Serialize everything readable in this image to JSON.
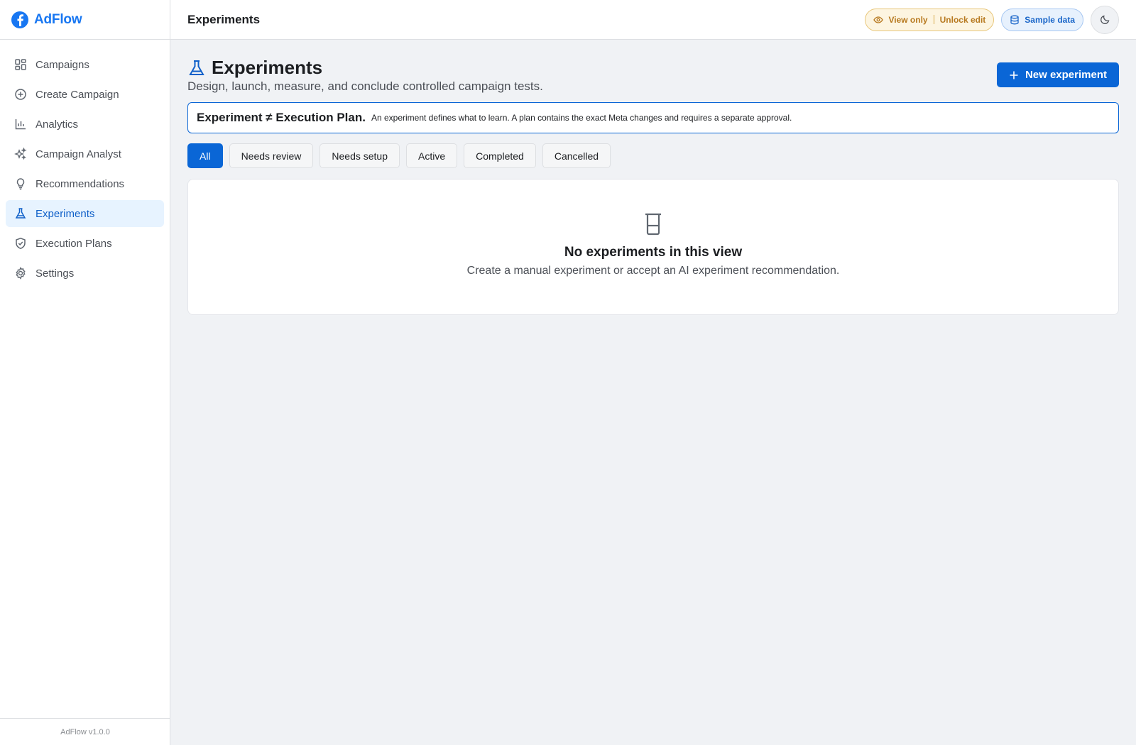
{
  "app": {
    "name": "AdFlow",
    "version": "AdFlow v1.0.0",
    "accent": "#1877f2"
  },
  "sidebar": {
    "items": [
      {
        "label": "Campaigns",
        "icon": "grid-icon"
      },
      {
        "label": "Create Campaign",
        "icon": "plus-circle-icon"
      },
      {
        "label": "Analytics",
        "icon": "bar-chart-icon"
      },
      {
        "label": "Campaign Analyst",
        "icon": "sparkles-icon"
      },
      {
        "label": "Recommendations",
        "icon": "lightbulb-icon"
      },
      {
        "label": "Experiments",
        "icon": "flask-icon",
        "active": true
      },
      {
        "label": "Execution Plans",
        "icon": "shield-check-icon"
      },
      {
        "label": "Settings",
        "icon": "gear-icon"
      }
    ]
  },
  "topbar": {
    "title": "Experiments",
    "view_only": "View only",
    "unlock_edit": "Unlock edit",
    "sample_data": "Sample data"
  },
  "main": {
    "title": "Experiments",
    "subtitle": "Design, launch, measure, and conclude controlled campaign tests.",
    "new_button": "New experiment",
    "callout": {
      "strong": "Experiment ≠ Execution Plan.",
      "text": "An experiment defines what to learn. A plan contains the exact Meta changes and requires a separate approval."
    },
    "tabs": [
      {
        "label": "All",
        "active": true
      },
      {
        "label": "Needs review"
      },
      {
        "label": "Needs setup"
      },
      {
        "label": "Active"
      },
      {
        "label": "Completed"
      },
      {
        "label": "Cancelled"
      }
    ],
    "empty": {
      "title": "No experiments in this view",
      "text": "Create a manual experiment or accept an AI experiment recommendation."
    }
  }
}
